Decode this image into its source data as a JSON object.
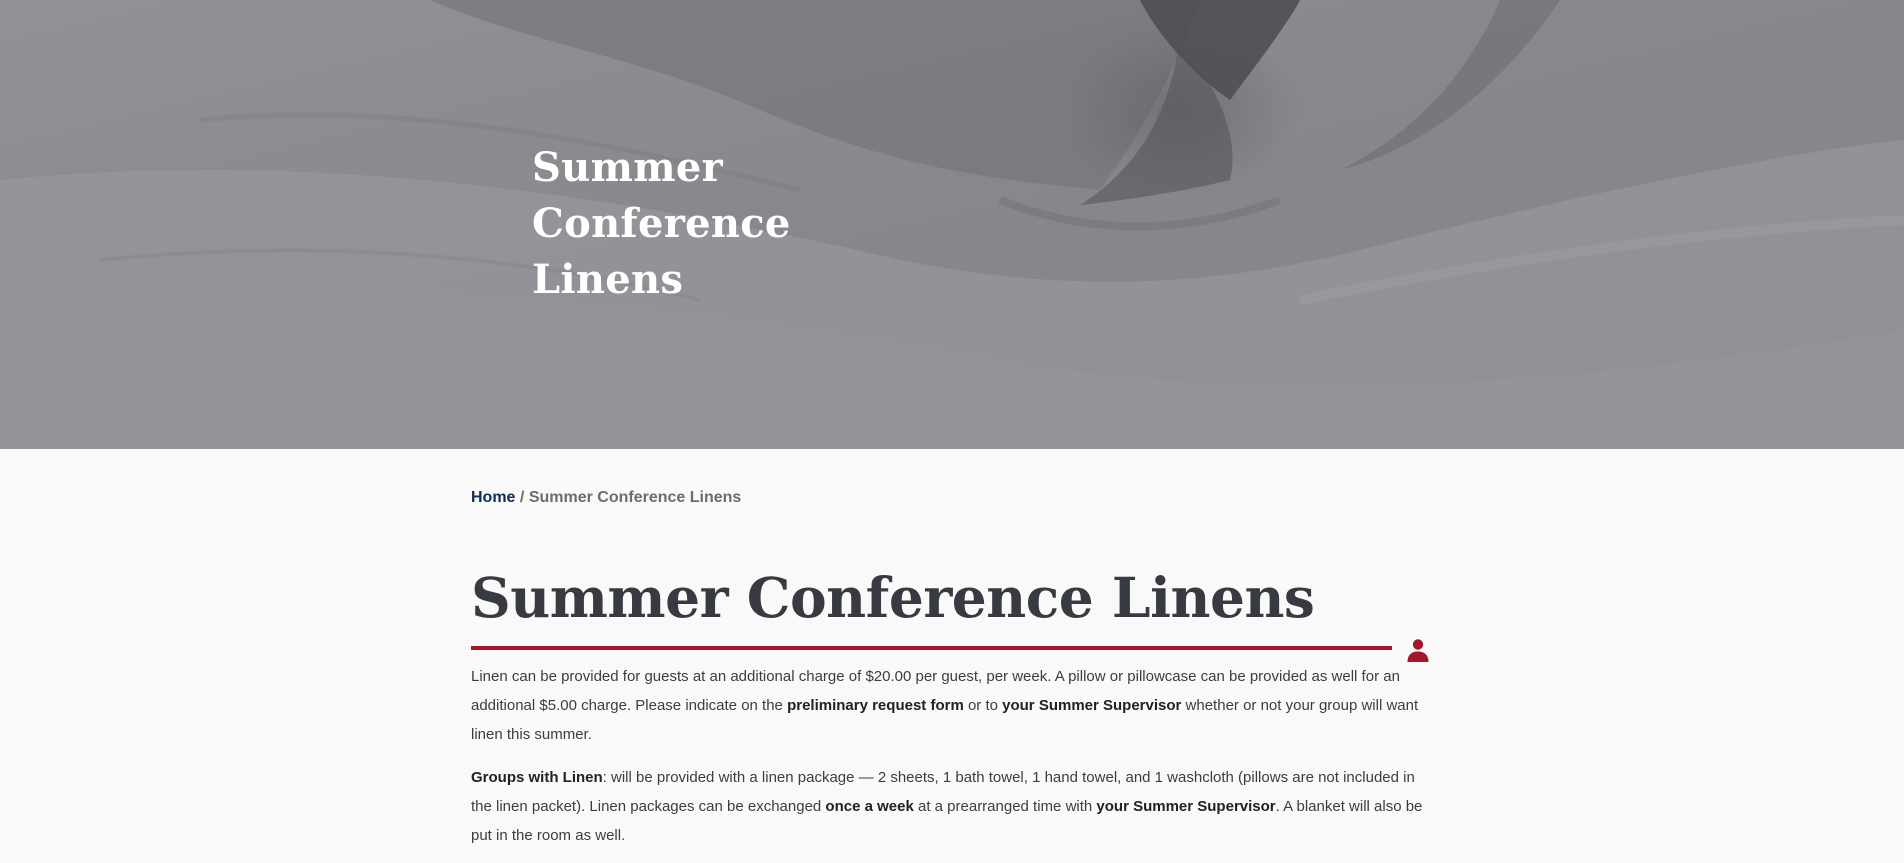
{
  "hero": {
    "title": "Summer Conference Linens"
  },
  "breadcrumb": {
    "home_label": "Home",
    "separator": "/",
    "current_label": "Summer Conference Linens"
  },
  "page": {
    "title": "Summer Conference Linens"
  },
  "icons": {
    "user": "user-icon"
  },
  "colors": {
    "accent": "#a3162c",
    "link": "#0d2d5a",
    "heading": "#373a40",
    "body_text": "#3b3d40"
  },
  "content": {
    "p1_a": "Linen can be provided for guests at an additional charge of $20.00 per guest, per week. A pillow or pillowcase can be provided as well for an additional $5.00 charge. Please indicate on the ",
    "p1_b": "preliminary request form",
    "p1_c": " or to ",
    "p1_d": "your Summer Supervisor",
    "p1_e": " whether or  not your group will want linen this summer.",
    "p2_a": "Groups with Linen",
    "p2_b": ": will be provided with a linen package — 2 sheets, 1 bath towel, 1 hand towel, and 1 washcloth (pillows are not included in the linen packet). Linen packages can be exchanged ",
    "p2_c": "once a week",
    "p2_d": " at a prearranged time with ",
    "p2_e": "your Summer Supervisor",
    "p2_f": ". A blanket will also be put in the room as well."
  }
}
